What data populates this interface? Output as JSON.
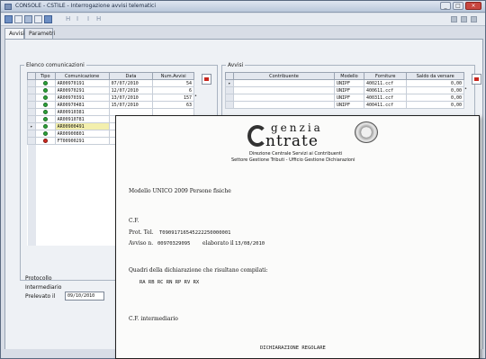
{
  "window": {
    "title": "CONSOLE - CSTILE - Interrogazione avvisi telematici"
  },
  "toolbar": {
    "nav_symbols": [
      "H",
      "I",
      "I",
      "H"
    ]
  },
  "tabs": [
    "Avvisi",
    "Parametri"
  ],
  "comunicazioni": {
    "label": "Elenco comunicazioni",
    "columns": [
      "Tipo",
      "Comunicazione",
      "Data",
      "Num.Avvisi"
    ],
    "rows": [
      {
        "status": "green",
        "code": "AR00970191",
        "date": "07/07/2010",
        "count": "54"
      },
      {
        "status": "green",
        "code": "AR00970291",
        "date": "12/07/2010",
        "count": "6"
      },
      {
        "status": "green",
        "code": "AR00970391",
        "date": "13/07/2010",
        "count": "157"
      },
      {
        "status": "green",
        "code": "AR00970481",
        "date": "15/07/2010",
        "count": "63"
      },
      {
        "status": "green",
        "code": "AR00910381",
        "date": "",
        "count": ""
      },
      {
        "status": "green",
        "code": "AR00910781",
        "date": "",
        "count": ""
      },
      {
        "status": "green",
        "code": "AR00900491",
        "date": "",
        "count": "",
        "selected": true
      },
      {
        "status": "green",
        "code": "AR00900801",
        "date": "",
        "count": ""
      },
      {
        "status": "red",
        "code": "FT00900291",
        "date": "",
        "count": ""
      }
    ]
  },
  "avvisi": {
    "label": "Avvisi",
    "columns": [
      "Contribuente",
      "Modello",
      "Forniture",
      "Saldo da versare"
    ],
    "rows": [
      {
        "contribuente": "",
        "modello": "UNIPF",
        "forniture": "400211.ccf",
        "saldo": "0,00"
      },
      {
        "contribuente": "",
        "modello": "UNIPF",
        "forniture": "400611.ccf",
        "saldo": "0,00"
      },
      {
        "contribuente": "",
        "modello": "UNIPF",
        "forniture": "400311.ccf",
        "saldo": "0,00"
      },
      {
        "contribuente": "",
        "modello": "UNIPF",
        "forniture": "400411.ccf",
        "saldo": "0,00"
      }
    ]
  },
  "left_panel": {
    "protocollo_label": "Protocollo",
    "intermediario_label": "Intermediario",
    "prelevato_label": "Prelevato il",
    "prelevato_value": "09/10/2010"
  },
  "document": {
    "logo_line1": "genzia",
    "logo_line2": "ntrate",
    "logo_sub1": "Direzione Centrale Servizi ai Contribuenti",
    "logo_sub2": "Settore Gestione Tributi - Ufficio Gestione Dichiarazioni",
    "modello_line": "Modello UNICO 2009 Persone fisiche",
    "cf_label": "C.F.",
    "prot_label": "Prot. Tel.",
    "prot_value": "T09091716545222250000001",
    "avviso_label": "Avviso n.",
    "avviso_value": "00970329095",
    "elaborato_label": "elaborato il",
    "elaborato_value": "13/08/2010",
    "quadri_label": "Quadri della dichiarazione che risultano compilati:",
    "quadri_value": "RA  RB  RC  RN  RP  RV  RX",
    "cf_intermediario_label": "C.F. intermediario",
    "dichiarazione_label": "DICHIARAZIONE REGOLARE"
  }
}
